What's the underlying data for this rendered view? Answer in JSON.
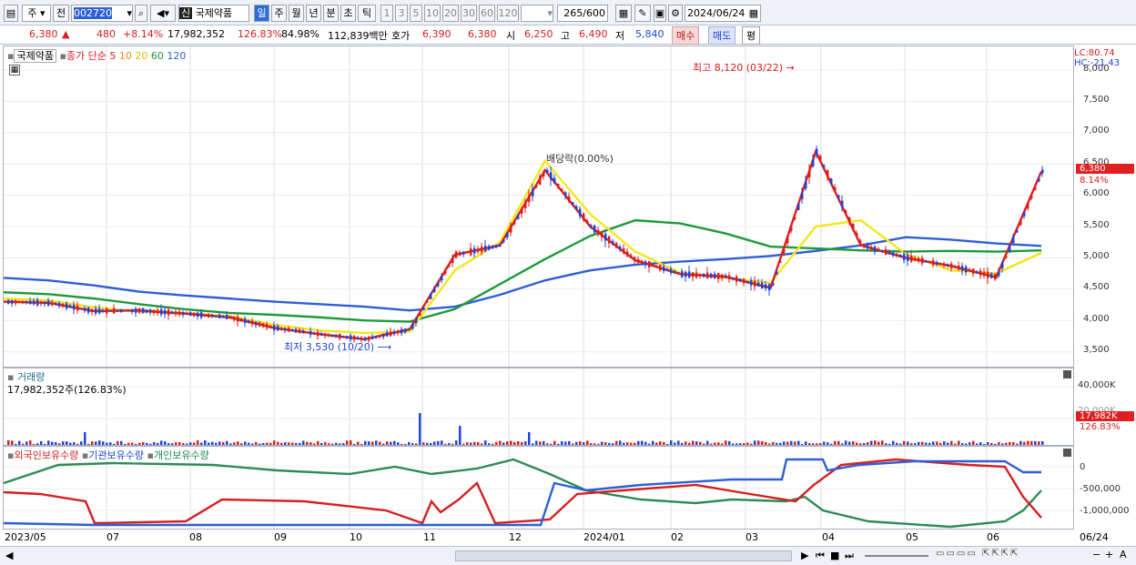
{
  "toolbar": {
    "mode": "주",
    "prev": "전",
    "code": "002720",
    "badge": "신",
    "stock_name": "국제약품",
    "periods": [
      "일",
      "주",
      "월",
      "년",
      "분",
      "초",
      "틱"
    ],
    "active_period": "일",
    "nums": [
      "1",
      "3",
      "5",
      "10",
      "20",
      "30",
      "60",
      "120"
    ],
    "count": "265",
    "total": "/600",
    "date": "2024/06/24"
  },
  "price_row": {
    "price": "6,380",
    "change": "480",
    "pct": "+8.14%",
    "volume": "17,982,352",
    "vol_pct": "126.83%",
    "ratio": "84.98%",
    "amount": "112,839백만",
    "bid_label": "호가",
    "bid1": "6,390",
    "bid2": "6,380",
    "open_label": "시",
    "open": "6,250",
    "high_label": "고",
    "high": "6,490",
    "low_label": "저",
    "low": "5,840",
    "buy": "매수",
    "sell": "매도",
    "eval": "평"
  },
  "main_chart": {
    "stock": "국제약품",
    "series_label": "종가 단순",
    "ma_labels": [
      "5",
      "10",
      "20",
      "60",
      "120"
    ],
    "lc": "LC:80.74",
    "hc": "HC:-21.43",
    "y_ticks": [
      "8,000",
      "7,500",
      "7,000",
      "6,500",
      "6,000",
      "5,500",
      "5,000",
      "4,500",
      "4,000",
      "3,500"
    ],
    "high_note": "최고 8,120 (03/22)",
    "low_note": "최저 3,530 (10/20)",
    "dividend_note": "배당락(0.00%)",
    "cur_price": "6,380",
    "cur_pct": "8.14%"
  },
  "volume_chart": {
    "title": "거래량",
    "value": "17,982,352주(126.83%)",
    "y_ticks": [
      "40,000K",
      "20,000K"
    ],
    "cur": "17,982K",
    "cur_pct": "126.83%"
  },
  "holdings_chart": {
    "legend": [
      "외국인보유수량",
      "기관보유수량",
      "개인보유수량"
    ],
    "y_ticks": [
      "0",
      "-500,000",
      "-1,000,000"
    ]
  },
  "x_axis": [
    "2023/05",
    "07",
    "08",
    "09",
    "10",
    "11",
    "12",
    "2024/01",
    "02",
    "03",
    "04",
    "05",
    "06",
    "06/24"
  ],
  "colors": {
    "up": "#d81e1e",
    "down": "#1e45d8",
    "ma5": "#e51b1b",
    "ma10": "#f08a1a",
    "ma20": "#f5e61a",
    "ma60": "#1e9a3a",
    "ma120": "#2d5fd6"
  },
  "chart_data": {
    "type": "line",
    "title": "국제약품",
    "series": [
      {
        "name": "120",
        "values": [
          4680,
          4640,
          4560,
          4460,
          4400,
          4350,
          4300,
          4260,
          4220,
          4160,
          4220,
          4410,
          4640,
          4800,
          4890,
          4940,
          4980,
          5030,
          5110,
          5200,
          5330,
          5290,
          5230,
          5190
        ]
      },
      {
        "name": "60",
        "values": [
          4450,
          4420,
          4350,
          4260,
          4180,
          4120,
          4090,
          4050,
          4000,
          3980,
          4180,
          4580,
          4980,
          5350,
          5600,
          5550,
          5390,
          5180,
          5150,
          5120,
          5100,
          5110,
          5100,
          5120
        ]
      },
      {
        "name": "20",
        "values": [
          4350,
          4320,
          4210,
          4140,
          4110,
          4070,
          3930,
          3840,
          3800,
          3820,
          4800,
          5250,
          6550,
          5700,
          5100,
          4760,
          4680,
          4600,
          5500,
          5600,
          5060,
          4800,
          4750,
          5080
        ]
      },
      {
        "name": "5",
        "values": [
          4300,
          4280,
          4150,
          4160,
          4110,
          4050,
          3880,
          3780,
          3700,
          3860,
          5050,
          5200,
          6400,
          5500,
          4960,
          4740,
          4700,
          4520,
          6700,
          5200,
          5000,
          4870,
          4690,
          6380
        ]
      }
    ],
    "x": [
      "2023/05",
      "06",
      "07",
      "07",
      "08",
      "08",
      "09",
      "09",
      "10",
      "10",
      "11",
      "11",
      "12",
      "2024/01",
      "01",
      "02",
      "02",
      "03",
      "03",
      "04",
      "04",
      "05",
      "06",
      "06/24"
    ]
  }
}
